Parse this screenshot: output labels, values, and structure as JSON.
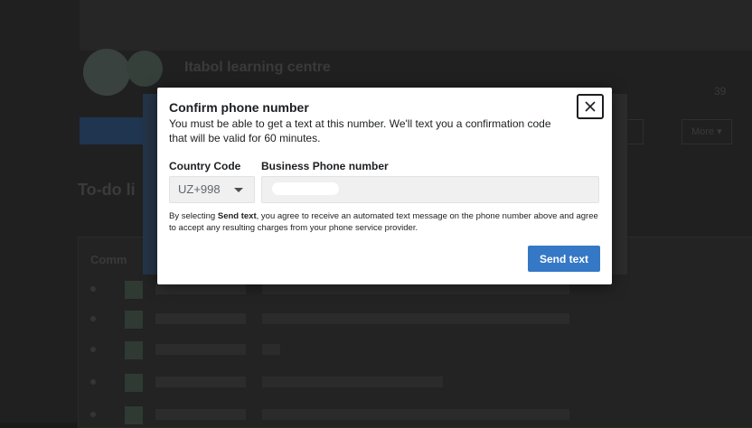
{
  "background": {
    "page_title": "Itabol learning centre",
    "stat_followers": "",
    "stat_count": "39",
    "tabs": [
      "",
      "More ▾"
    ],
    "section_heading": "To-do li",
    "section_sub": "",
    "panel_heading": "Comm",
    "rows": [
      {
        "name": "",
        "message": ""
      },
      {
        "name": "",
        "message": ""
      },
      {
        "name": "",
        "message": ""
      },
      {
        "name": "",
        "message": ""
      },
      {
        "name": "",
        "message": ""
      }
    ]
  },
  "dialog": {
    "title": "Confirm phone number",
    "description": "You must be able to get a text at this number. We'll text you a confirmation code that will be valid for 60 minutes.",
    "country_code_label": "Country Code",
    "country_code_value": "UZ+998",
    "phone_label": "Business Phone number",
    "phone_value": "",
    "consent_prefix": "By selecting ",
    "consent_bold": "Send text",
    "consent_suffix": ", you agree to receive an automated text message on the phone number above and agree to accept any resulting charges from your phone service provider.",
    "send_button": "Send text",
    "close_icon": "close-icon"
  },
  "colors": {
    "primary_button": "#3578c6",
    "overlay": "#1b1b1b",
    "input_background": "#f0f0f0"
  }
}
